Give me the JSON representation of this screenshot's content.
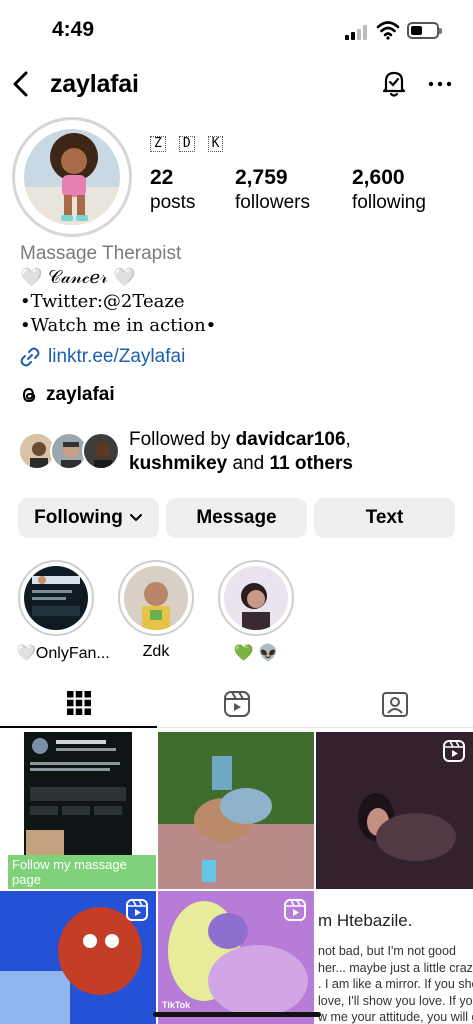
{
  "status_bar": {
    "time": "4:49"
  },
  "header": {
    "username": "zaylafai"
  },
  "profile": {
    "name_glyphs": [
      "Z",
      "D",
      "K"
    ],
    "stats": [
      {
        "value": "22",
        "label": "posts"
      },
      {
        "value": "2,759",
        "label": "followers"
      },
      {
        "value": "2,600",
        "label": "following"
      }
    ],
    "category": "Massage Therapist",
    "bio_lines": [
      "🤍 𝒞𝒶𝓃𝒸𝑒𝓇 🤍",
      "•Twitter:@2Teaze",
      "•Watch me in action•"
    ],
    "link": "linktr.ee/Zaylafai",
    "threads_handle": "zaylafai",
    "followed_by": {
      "prefix": "Followed by ",
      "user1": "davidcar106",
      "sep": ",",
      "user2": "kushmikey",
      "mid": " and ",
      "others": "11 others"
    }
  },
  "buttons": {
    "following": "Following",
    "message": "Message",
    "text": "Text"
  },
  "highlights": [
    {
      "label": "🤍OnlyFan..."
    },
    {
      "label": "Zdk"
    },
    {
      "label": "💚 👽"
    }
  ],
  "grid": {
    "post1_caption": "Follow my massage page",
    "post5_badge": "TikTok",
    "post6_heading": "m Htebazile.",
    "post6_text": "not bad, but I'm not good\nher... maybe just a little crazy\n. I am like a mirror. If you sho\nlove, I'll show you love. If you\nw me your attitude, you will g\nsame in return. 😊"
  },
  "colors": {
    "link": "#1c5fae",
    "button_bg": "#efefef",
    "muted": "#7a7a7a"
  }
}
